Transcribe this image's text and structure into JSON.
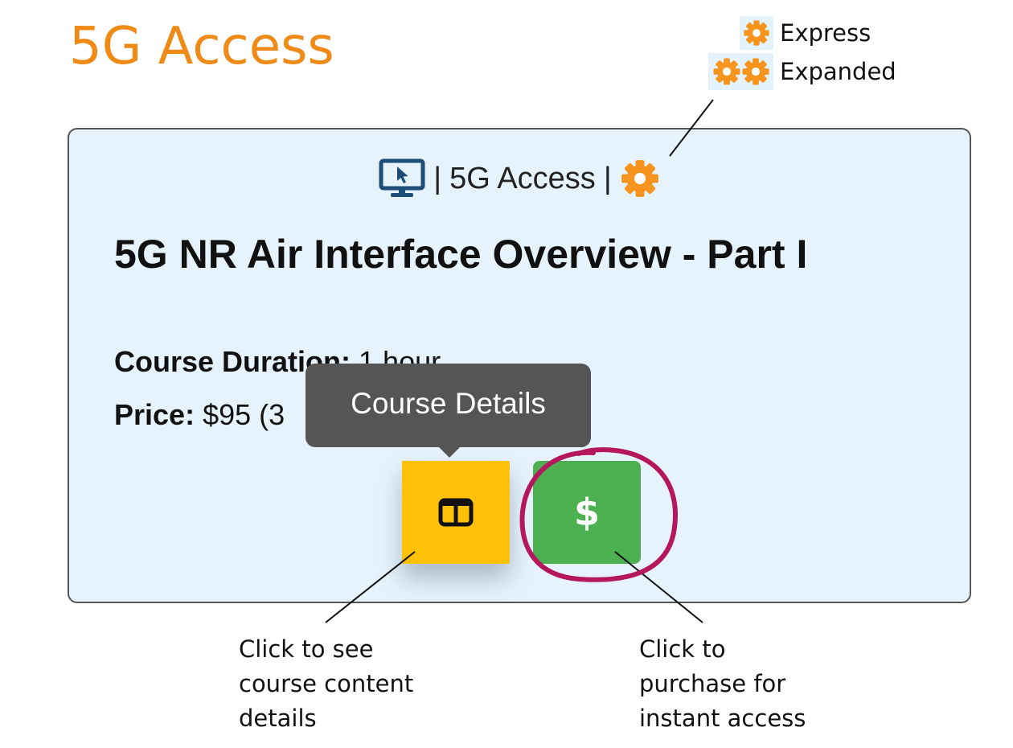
{
  "page": {
    "heading": "5G Access"
  },
  "legend": {
    "express_label": "Express",
    "expanded_label": "Expanded",
    "gear_color": "#f7941d"
  },
  "card": {
    "header": {
      "separator_left": "|",
      "category": "5G Access",
      "separator_right": "|",
      "icons": [
        "monitor-cursor-icon",
        "gear-icon"
      ]
    },
    "title": "5G NR Air Interface Overview - Part I",
    "duration_label": "Course Duration:",
    "duration_value": "1 hour",
    "price_label": "Price:",
    "price_value": "$95 (3",
    "tooltip": "Course Details",
    "buttons": {
      "details_icon": "columns-icon",
      "purchase_symbol": "$"
    },
    "colors": {
      "card_bg": "#e6f3fd",
      "details_button": "#ffc107",
      "purchase_button": "#4caf50",
      "tooltip_bg": "#555555"
    }
  },
  "annotations": {
    "details_lines": [
      "Click to see",
      "course content",
      "details"
    ],
    "purchase_lines": [
      "Click to",
      "purchase for",
      "instant access"
    ],
    "highlight_color": "#b5175f"
  }
}
